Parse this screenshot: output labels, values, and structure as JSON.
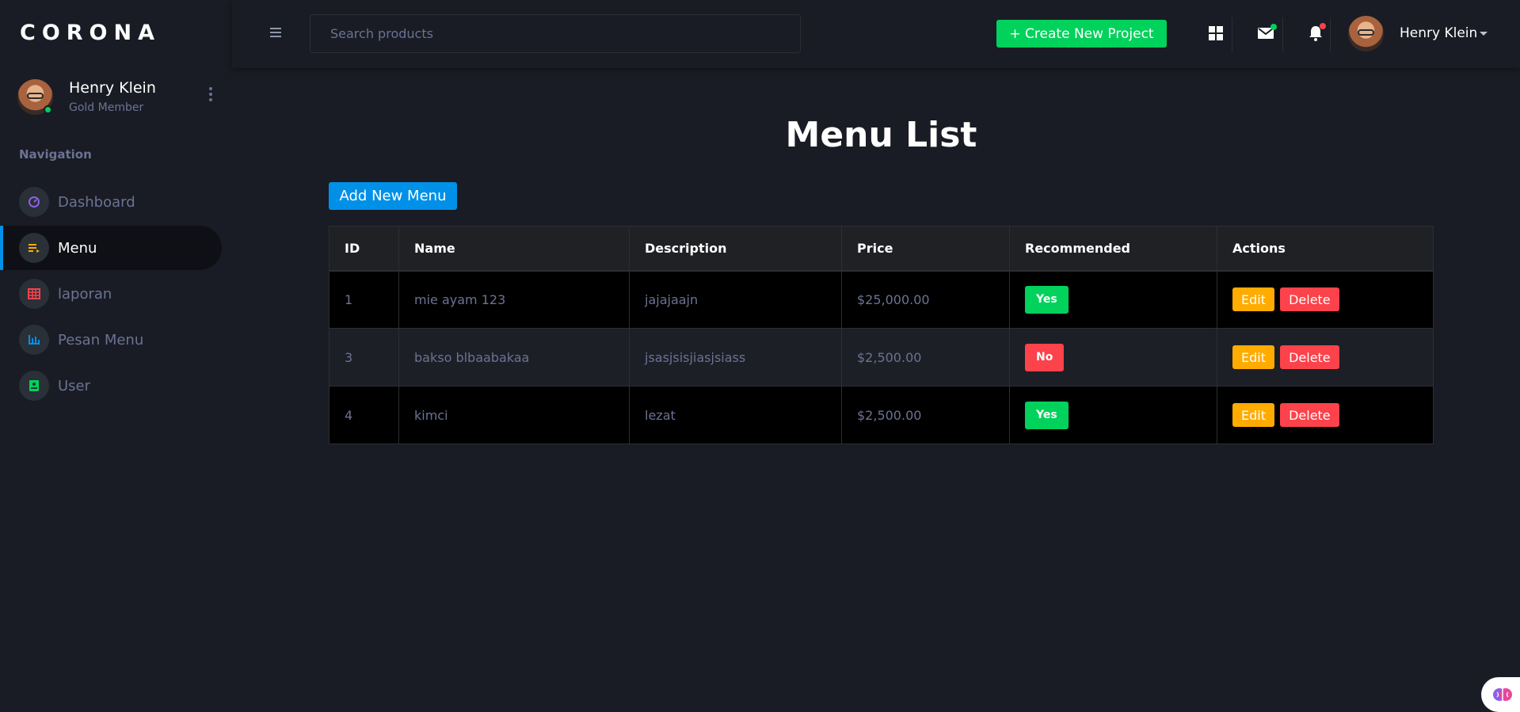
{
  "brand": "CORONA",
  "profile": {
    "name": "Henry Klein",
    "role": "Gold Member"
  },
  "nav": {
    "title": "Navigation",
    "items": [
      {
        "label": "Dashboard",
        "icon": "speedometer-icon",
        "color": "#8f5fe8"
      },
      {
        "label": "Menu",
        "icon": "playlist-icon",
        "color": "#ffab00",
        "active": true
      },
      {
        "label": "laporan",
        "icon": "table-icon",
        "color": "#fc424a"
      },
      {
        "label": "Pesan Menu",
        "icon": "chart-bar-icon",
        "color": "#0090e7"
      },
      {
        "label": "User",
        "icon": "contacts-icon",
        "color": "#00d25b"
      }
    ]
  },
  "topbar": {
    "search_placeholder": "Search products",
    "create_label": "+ Create New Project",
    "username": "Henry Klein"
  },
  "main": {
    "title": "Menu List",
    "add_label": "Add New Menu",
    "columns": [
      "ID",
      "Name",
      "Description",
      "Price",
      "Recommended",
      "Actions"
    ],
    "rows": [
      {
        "id": "1",
        "name": "mie ayam 123",
        "description": "jajajaajn",
        "price": "$25,000.00",
        "recommended": "Yes"
      },
      {
        "id": "3",
        "name": "bakso blbaabakaa",
        "description": "jsasjsisjiasjsiass",
        "price": "$2,500.00",
        "recommended": "No"
      },
      {
        "id": "4",
        "name": "kimci",
        "description": "lezat",
        "price": "$2,500.00",
        "recommended": "Yes"
      }
    ],
    "edit_label": "Edit",
    "delete_label": "Delete"
  },
  "colors": {
    "background": "#191c24",
    "accent_blue": "#0090e7",
    "success": "#00d25b",
    "danger": "#fc424a",
    "warning": "#ffab00"
  }
}
